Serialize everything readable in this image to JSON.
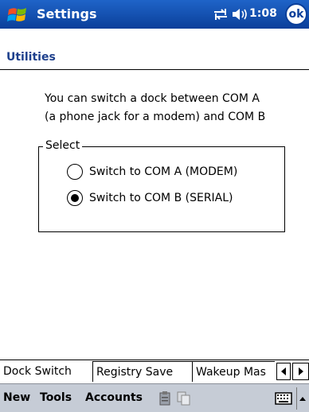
{
  "titlebar": {
    "title": "Settings",
    "clock": "1:08",
    "ok_label": "ok",
    "start_icon": "windows-flag-icon",
    "connectivity_icon": "connectivity-icon",
    "volume_icon": "volume-icon"
  },
  "header": {
    "title": "Utilities"
  },
  "description": {
    "line1": "You can switch a dock between COM A",
    "line2": "(a phone jack for a modem) and COM B"
  },
  "select_group": {
    "legend": "Select",
    "options": [
      {
        "label": "Switch to COM A (MODEM)",
        "checked": false
      },
      {
        "label": "Switch to COM B (SERIAL)",
        "checked": true
      }
    ]
  },
  "tabs": [
    {
      "label": "Dock Switch",
      "active": true
    },
    {
      "label": "Registry Save",
      "active": false
    },
    {
      "label": "Wakeup Mas",
      "active": false
    }
  ],
  "menubar": {
    "items": [
      "New",
      "Tools",
      "Accounts"
    ],
    "icons": [
      "clipboard-icon",
      "copy-icon"
    ],
    "keyboard_icon": "keyboard-icon"
  },
  "colors": {
    "titlebar": "#0b3f9a",
    "header_text": "#1d3f8c",
    "menubar": "#c6ccd6"
  }
}
